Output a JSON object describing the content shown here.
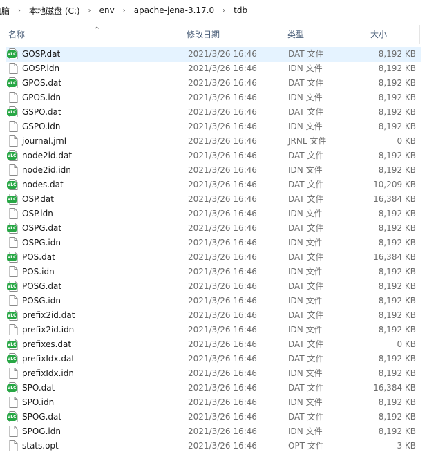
{
  "breadcrumb": {
    "items": [
      "电脑",
      "本地磁盘 (C:)",
      "env",
      "apache-jena-3.17.0",
      "tdb"
    ],
    "separator": "›"
  },
  "columns": {
    "name": "名称",
    "date": "修改日期",
    "type": "类型",
    "size": "大小"
  },
  "files": [
    {
      "name": "GOSP.dat",
      "date": "2021/3/26 16:46",
      "type": "DAT 文件",
      "size": "8,192 KB",
      "icon": "dat-file-icon"
    },
    {
      "name": "GOSP.idn",
      "date": "2021/3/26 16:46",
      "type": "IDN 文件",
      "size": "8,192 KB",
      "icon": "generic-file-icon"
    },
    {
      "name": "GPOS.dat",
      "date": "2021/3/26 16:46",
      "type": "DAT 文件",
      "size": "8,192 KB",
      "icon": "dat-file-icon"
    },
    {
      "name": "GPOS.idn",
      "date": "2021/3/26 16:46",
      "type": "IDN 文件",
      "size": "8,192 KB",
      "icon": "generic-file-icon"
    },
    {
      "name": "GSPO.dat",
      "date": "2021/3/26 16:46",
      "type": "DAT 文件",
      "size": "8,192 KB",
      "icon": "dat-file-icon"
    },
    {
      "name": "GSPO.idn",
      "date": "2021/3/26 16:46",
      "type": "IDN 文件",
      "size": "8,192 KB",
      "icon": "generic-file-icon"
    },
    {
      "name": "journal.jrnl",
      "date": "2021/3/26 16:46",
      "type": "JRNL 文件",
      "size": "0 KB",
      "icon": "generic-file-icon"
    },
    {
      "name": "node2id.dat",
      "date": "2021/3/26 16:46",
      "type": "DAT 文件",
      "size": "8,192 KB",
      "icon": "dat-file-icon"
    },
    {
      "name": "node2id.idn",
      "date": "2021/3/26 16:46",
      "type": "IDN 文件",
      "size": "8,192 KB",
      "icon": "generic-file-icon"
    },
    {
      "name": "nodes.dat",
      "date": "2021/3/26 16:46",
      "type": "DAT 文件",
      "size": "10,209 KB",
      "icon": "dat-file-icon"
    },
    {
      "name": "OSP.dat",
      "date": "2021/3/26 16:46",
      "type": "DAT 文件",
      "size": "16,384 KB",
      "icon": "dat-file-icon"
    },
    {
      "name": "OSP.idn",
      "date": "2021/3/26 16:46",
      "type": "IDN 文件",
      "size": "8,192 KB",
      "icon": "generic-file-icon"
    },
    {
      "name": "OSPG.dat",
      "date": "2021/3/26 16:46",
      "type": "DAT 文件",
      "size": "8,192 KB",
      "icon": "dat-file-icon"
    },
    {
      "name": "OSPG.idn",
      "date": "2021/3/26 16:46",
      "type": "IDN 文件",
      "size": "8,192 KB",
      "icon": "generic-file-icon"
    },
    {
      "name": "POS.dat",
      "date": "2021/3/26 16:46",
      "type": "DAT 文件",
      "size": "16,384 KB",
      "icon": "dat-file-icon"
    },
    {
      "name": "POS.idn",
      "date": "2021/3/26 16:46",
      "type": "IDN 文件",
      "size": "8,192 KB",
      "icon": "generic-file-icon"
    },
    {
      "name": "POSG.dat",
      "date": "2021/3/26 16:46",
      "type": "DAT 文件",
      "size": "8,192 KB",
      "icon": "dat-file-icon"
    },
    {
      "name": "POSG.idn",
      "date": "2021/3/26 16:46",
      "type": "IDN 文件",
      "size": "8,192 KB",
      "icon": "generic-file-icon"
    },
    {
      "name": "prefix2id.dat",
      "date": "2021/3/26 16:46",
      "type": "DAT 文件",
      "size": "8,192 KB",
      "icon": "dat-file-icon"
    },
    {
      "name": "prefix2id.idn",
      "date": "2021/3/26 16:46",
      "type": "IDN 文件",
      "size": "8,192 KB",
      "icon": "generic-file-icon"
    },
    {
      "name": "prefixes.dat",
      "date": "2021/3/26 16:46",
      "type": "DAT 文件",
      "size": "0 KB",
      "icon": "dat-file-icon"
    },
    {
      "name": "prefixIdx.dat",
      "date": "2021/3/26 16:46",
      "type": "DAT 文件",
      "size": "8,192 KB",
      "icon": "dat-file-icon"
    },
    {
      "name": "prefixIdx.idn",
      "date": "2021/3/26 16:46",
      "type": "IDN 文件",
      "size": "8,192 KB",
      "icon": "generic-file-icon"
    },
    {
      "name": "SPO.dat",
      "date": "2021/3/26 16:46",
      "type": "DAT 文件",
      "size": "16,384 KB",
      "icon": "dat-file-icon"
    },
    {
      "name": "SPO.idn",
      "date": "2021/3/26 16:46",
      "type": "IDN 文件",
      "size": "8,192 KB",
      "icon": "generic-file-icon"
    },
    {
      "name": "SPOG.dat",
      "date": "2021/3/26 16:46",
      "type": "DAT 文件",
      "size": "8,192 KB",
      "icon": "dat-file-icon"
    },
    {
      "name": "SPOG.idn",
      "date": "2021/3/26 16:46",
      "type": "IDN 文件",
      "size": "8,192 KB",
      "icon": "generic-file-icon"
    },
    {
      "name": "stats.opt",
      "date": "2021/3/26 16:46",
      "type": "OPT 文件",
      "size": "3 KB",
      "icon": "generic-file-icon"
    }
  ],
  "selected_index": 0,
  "colors": {
    "selection": "#e5f3ff",
    "header_text": "#4c607a",
    "dat_badge": "#28a745"
  },
  "sort_indicator": "^"
}
